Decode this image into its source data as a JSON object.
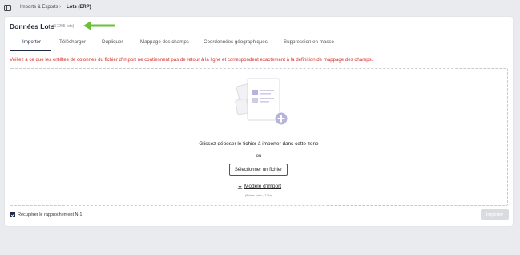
{
  "breadcrumb": {
    "items": [
      "Imports & Exports",
      "Lots (ERP)"
    ],
    "separator": "›"
  },
  "page": {
    "title": "Données Lots",
    "count": "(17205 lots)"
  },
  "tabs": [
    {
      "label": "Importer",
      "active": true
    },
    {
      "label": "Télécharger",
      "active": false
    },
    {
      "label": "Dupliquer",
      "active": false
    },
    {
      "label": "Mappage des champs",
      "active": false
    },
    {
      "label": "Coordonnées géographiques",
      "active": false
    },
    {
      "label": "Suppression en masse",
      "active": false
    }
  ],
  "warning": "Veillez à ce que les entêtes de colonnes du fichier d'import ne contiennent pas de retour à la ligne et correspondent exactement à la définition de mappage des champs.",
  "dropzone": {
    "title": "Glissez-déposer le fichier à importer dans cette zone",
    "or": "ou",
    "select_button": "Sélectionner un fichier",
    "template_link": "Modèle d'import",
    "template_hint": "(fichier .xlsx ; 12ko)"
  },
  "footer": {
    "checkbox_label": "Récupérer le rapprochement N-1",
    "checkbox_checked": true,
    "import_button": "Importer"
  },
  "icons": {
    "sidebar": "sidebar-toggle-icon",
    "arrow": "arrow-left-icon",
    "illustration": "document-upload-illustration",
    "download": "download-icon",
    "check": "check-icon"
  },
  "colors": {
    "primary": "#1f2a44",
    "warning": "#d0302b",
    "arrow": "#6bbf3a",
    "illustration_accent": "#b7b3dc",
    "button_disabled": "#d9dbe0",
    "background": "#e9ebef"
  }
}
